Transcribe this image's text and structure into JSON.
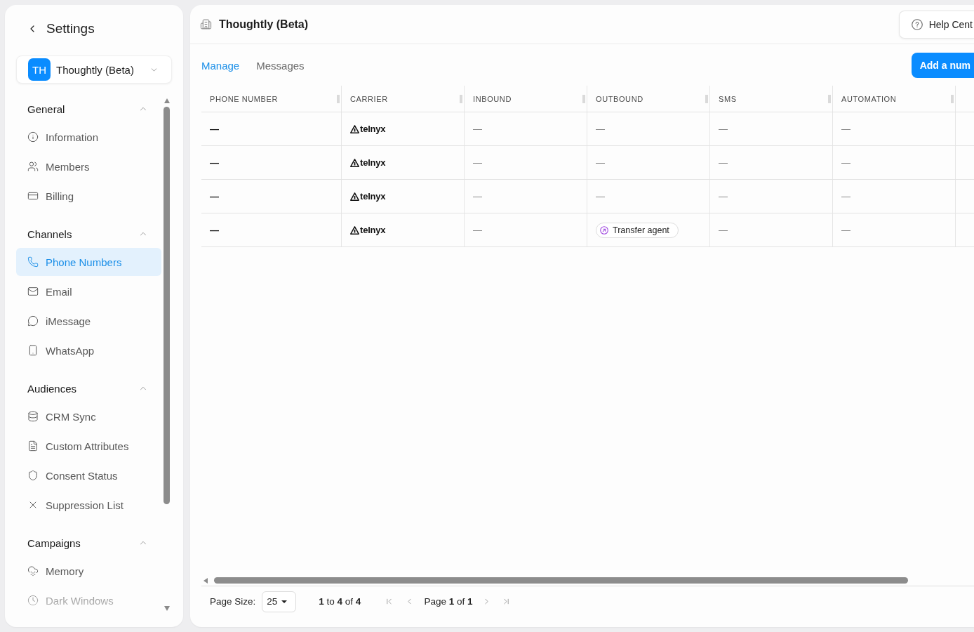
{
  "sidebar": {
    "title": "Settings",
    "workspace": {
      "initials": "TH",
      "name": "Thoughtly (Beta)"
    },
    "sections": [
      {
        "title": "General",
        "expanded": true,
        "items": [
          {
            "label": "Information",
            "selected": false
          },
          {
            "label": "Members",
            "selected": false
          },
          {
            "label": "Billing",
            "selected": false
          }
        ]
      },
      {
        "title": "Channels",
        "expanded": true,
        "items": [
          {
            "label": "Phone Numbers",
            "selected": true
          },
          {
            "label": "Email",
            "selected": false
          },
          {
            "label": "iMessage",
            "selected": false
          },
          {
            "label": "WhatsApp",
            "selected": false
          }
        ]
      },
      {
        "title": "Audiences",
        "expanded": true,
        "items": [
          {
            "label": "CRM Sync",
            "selected": false
          },
          {
            "label": "Custom Attributes",
            "selected": false
          },
          {
            "label": "Consent Status",
            "selected": false
          },
          {
            "label": "Suppression List",
            "selected": false
          }
        ]
      },
      {
        "title": "Campaigns",
        "expanded": true,
        "items": [
          {
            "label": "Memory",
            "selected": false
          },
          {
            "label": "Dark Windows",
            "selected": false
          }
        ]
      }
    ]
  },
  "header": {
    "title": "Thoughtly (Beta)",
    "help_button": "Help Cent"
  },
  "tabs": [
    {
      "label": "Manage",
      "selected": true
    },
    {
      "label": "Messages",
      "selected": false
    }
  ],
  "add_button": "Add a num",
  "table": {
    "columns": [
      "PHONE NUMBER",
      "CARRIER",
      "INBOUND",
      "OUTBOUND",
      "SMS",
      "AUTOMATION"
    ],
    "rows": [
      {
        "cells": [
          {
            "kind": "text",
            "text": "—"
          },
          {
            "kind": "carrier",
            "text": "telnyx"
          },
          {
            "kind": "text",
            "text": "—"
          },
          {
            "kind": "text",
            "text": "—"
          },
          {
            "kind": "text",
            "text": "—"
          },
          {
            "kind": "text",
            "text": "—"
          }
        ]
      },
      {
        "cells": [
          {
            "kind": "text",
            "text": "—"
          },
          {
            "kind": "carrier",
            "text": "telnyx"
          },
          {
            "kind": "text",
            "text": "—"
          },
          {
            "kind": "text",
            "text": "—"
          },
          {
            "kind": "text",
            "text": "—"
          },
          {
            "kind": "text",
            "text": "—"
          }
        ]
      },
      {
        "cells": [
          {
            "kind": "text",
            "text": "—"
          },
          {
            "kind": "carrier",
            "text": "telnyx"
          },
          {
            "kind": "text",
            "text": "—"
          },
          {
            "kind": "text",
            "text": "—"
          },
          {
            "kind": "text",
            "text": "—"
          },
          {
            "kind": "text",
            "text": "—"
          }
        ]
      },
      {
        "cells": [
          {
            "kind": "text",
            "text": "—"
          },
          {
            "kind": "carrier",
            "text": "telnyx"
          },
          {
            "kind": "text",
            "text": "—"
          },
          {
            "kind": "tag",
            "text": "Transfer agent"
          },
          {
            "kind": "text",
            "text": "—"
          },
          {
            "kind": "text",
            "text": "—"
          }
        ]
      }
    ]
  },
  "pagination": {
    "page_size_label": "Page Size:",
    "page_size": "25",
    "range": "**1** to **4** of **4**",
    "page": "Page **1** of **1**"
  }
}
